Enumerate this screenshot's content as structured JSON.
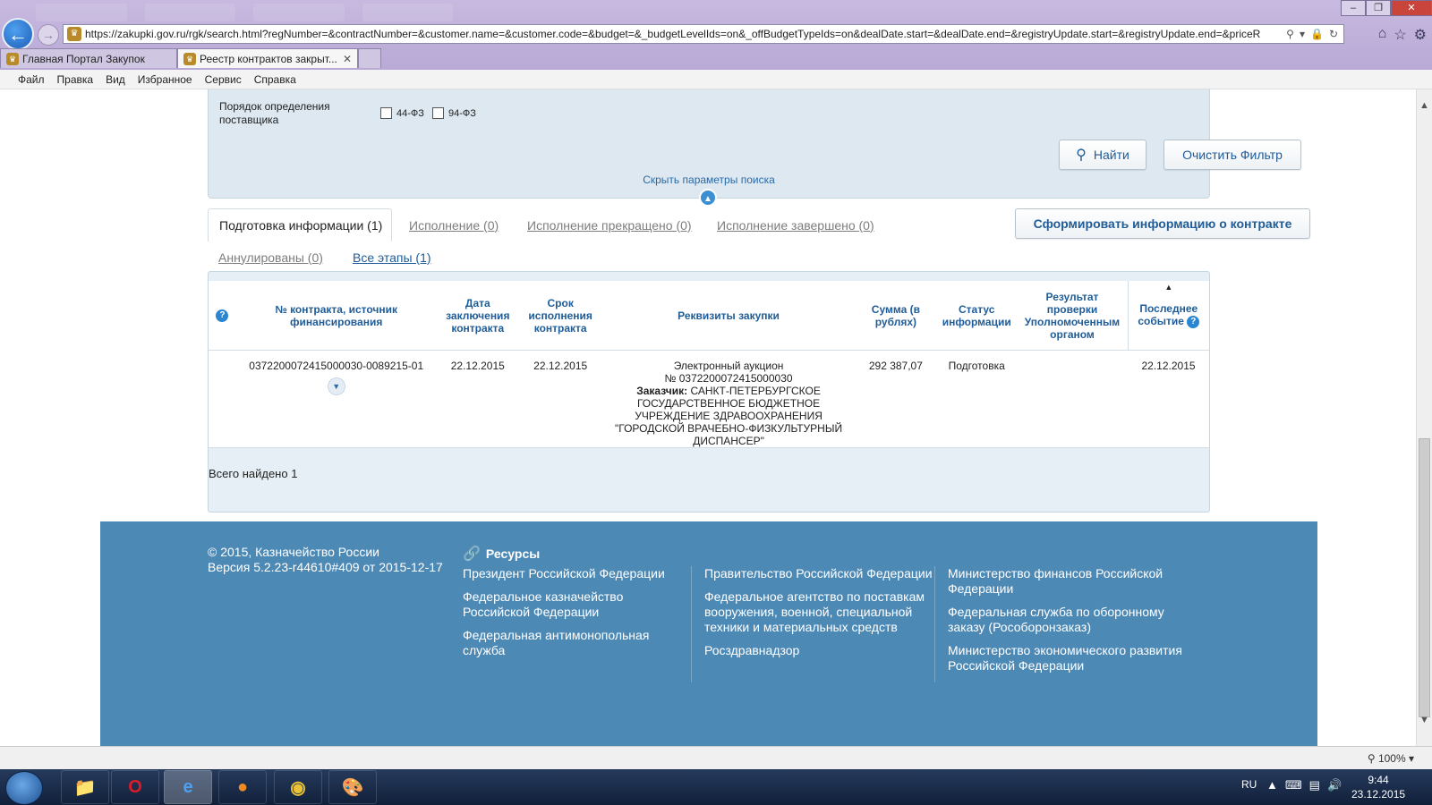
{
  "browser": {
    "url": "https://zakupki.gov.ru/rgk/search.html?regNumber=&contractNumber=&customer.name=&customer.code=&budget=&_budgetLevelIds=on&_offBudgetTypeIds=on&dealDate.start=&dealDate.end=&registryUpdate.start=&registryUpdate.end=&priceR",
    "tabs": [
      {
        "label": "Главная Портал Закупок",
        "active": false
      },
      {
        "label": "Реестр контрактов закрыт...",
        "active": true
      }
    ],
    "menu": [
      "Файл",
      "Правка",
      "Вид",
      "Избранное",
      "Сервис",
      "Справка"
    ],
    "zoom": "100%"
  },
  "filter": {
    "method_label": "Порядок определения поставщика",
    "cb1": "44-ФЗ",
    "cb2": "94-ФЗ",
    "search_button": "Найти",
    "clear_button": "Очистить Фильтр",
    "hide_link": "Скрыть параметры поиска"
  },
  "stage_tabs": {
    "prep": "Подготовка информации (1)",
    "exec": "Исполнение (0)",
    "stopped": "Исполнение прекращено (0)",
    "done": "Исполнение завершено (0)",
    "cancelled": "Аннулированы (0)",
    "all": "Все этапы (1)",
    "form_button": "Сформировать информацию о контракте"
  },
  "table": {
    "headers": {
      "contract": "№ контракта, источник финансирования",
      "date": "Дата заключения контракта",
      "term": "Срок исполнения контракта",
      "requisites": "Реквизиты закупки",
      "sum": "Сумма (в рублях)",
      "status": "Статус информации",
      "check": "Результат проверки Уполномоченным органом",
      "last": "Последнее событие"
    },
    "row": {
      "contract": "0372200072415000030-0089215-01",
      "date": "22.12.2015",
      "term": "22.12.2015",
      "req_type": "Электронный аукцион",
      "req_num": "№ 0372200072415000030",
      "req_customer_label": "Заказчик:",
      "req_customer": "САНКТ-ПЕТЕРБУРГСКОЕ ГОСУДАРСТВЕННОЕ БЮДЖЕТНОЕ УЧРЕЖДЕНИЕ ЗДРАВООХРАНЕНИЯ \"ГОРОДСКОЙ ВРАЧЕБНО-ФИЗКУЛЬТУРНЫЙ ДИСПАНСЕР\"",
      "sum": "292 387,07",
      "status": "Подготовка",
      "check": "",
      "last": "22.12.2015"
    },
    "total": "Всего найдено 1"
  },
  "footer": {
    "copyright": "© 2015, Казначейство России",
    "version": "Версия 5.2.23-r44610#409 от 2015-12-17",
    "resources_title": "Ресурсы",
    "col1": [
      "Президент Российской Федерации",
      "Федеральное казначейство Российской Федерации",
      "Федеральная антимонопольная служба"
    ],
    "col2": [
      "Правительство Российской Федерации",
      "Федеральное агентство по поставкам вооружения, военной, специальной техники и материальных средств",
      "Росздравнадзор"
    ],
    "col3": [
      "Министерство финансов Российской Федерации",
      "Федеральная служба по оборонному заказу (Рособоронзаказ)",
      "Министерство экономического развития Российской Федерации"
    ]
  },
  "taskbar": {
    "lang": "RU",
    "time": "9:44",
    "date": "23.12.2015"
  }
}
